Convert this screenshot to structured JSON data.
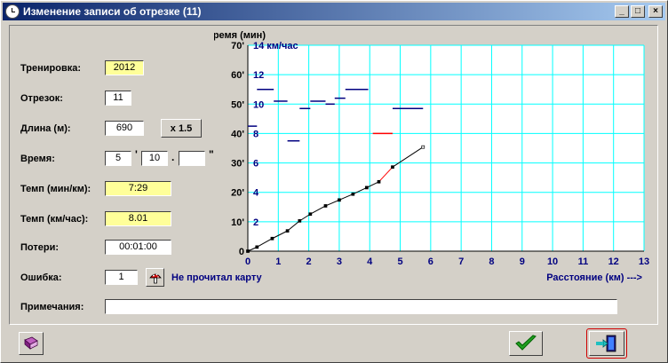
{
  "window": {
    "title": "Изменение записи об отрезке (11)",
    "min_label": "_",
    "max_label": "□",
    "close_label": "×"
  },
  "form": {
    "training_label": "Тренировка:",
    "training_value": "2012",
    "segment_label": "Отрезок:",
    "segment_value": "11",
    "length_label": "Длина (м):",
    "length_value": "690",
    "multiply_button": "x 1.5",
    "time_label": "Время:",
    "time_min": "5",
    "time_sep1": "'",
    "time_sec": "10",
    "time_sep2": ".",
    "time_frac": "",
    "time_sep3": "\"",
    "pace_label": "Темп (мин/км):",
    "pace_value": "7:29",
    "speed_label": "Темп (км/час):",
    "speed_value": "8.01",
    "loss_label": "Потери:",
    "loss_value": "00:01:00",
    "error_label": "Ошибка:",
    "error_value": "1",
    "error_note": "Не прочитал карту",
    "notes_label": "Примечания:",
    "notes_value": ""
  },
  "buttons": {
    "book_icon": "book-icon",
    "ok_icon": "checkmark-icon",
    "exit_icon": "exit-door-icon"
  },
  "colors": {
    "plot_grid": "#00ffff",
    "speed_bar": "#000080",
    "current_segment": "#ff0000",
    "axis_text": "#000080"
  },
  "chart_data": {
    "type": "line",
    "ylabel": "Время (мин)",
    "xlabel": "Расстояние (км) --->",
    "x_ticks": [
      "0",
      "1",
      "2",
      "3",
      "4",
      "5",
      "6",
      "7",
      "8",
      "9",
      "10",
      "11",
      "12",
      "13"
    ],
    "y_ticks": [
      "0",
      "10'",
      "20'",
      "30'",
      "40'",
      "50'",
      "60'",
      "70'"
    ],
    "speed_ticks": [
      "2",
      "4",
      "6",
      "8",
      "10",
      "12"
    ],
    "speed_top_label": "14 км/час",
    "xlim": [
      0,
      13
    ],
    "ylim": [
      0,
      70
    ],
    "speed_lim": [
      0,
      14
    ],
    "cumulative": {
      "x": [
        0,
        0.3,
        0.8,
        1.3,
        1.7,
        2.05,
        2.55,
        3.0,
        3.45,
        3.9,
        4.3,
        4.75,
        5.75
      ],
      "y": [
        0,
        1.4,
        4.3,
        6.9,
        10.3,
        12.6,
        15.4,
        17.4,
        19.4,
        21.6,
        23.6,
        28.6,
        35.4
      ],
      "highlight_segment_index": 10
    },
    "speed_bars": [
      {
        "x0": 0.0,
        "x1": 0.3,
        "speed": 8.5
      },
      {
        "x0": 0.3,
        "x1": 0.85,
        "speed": 11.0
      },
      {
        "x0": 0.85,
        "x1": 1.3,
        "speed": 10.2
      },
      {
        "x0": 1.3,
        "x1": 1.7,
        "speed": 7.5
      },
      {
        "x0": 1.7,
        "x1": 2.05,
        "speed": 9.7
      },
      {
        "x0": 2.05,
        "x1": 2.55,
        "speed": 10.2
      },
      {
        "x0": 2.55,
        "x1": 2.85,
        "speed": 10.0
      },
      {
        "x0": 2.85,
        "x1": 3.2,
        "speed": 10.4
      },
      {
        "x0": 3.2,
        "x1": 3.95,
        "speed": 11.0
      },
      {
        "x0": 4.1,
        "x1": 4.75,
        "speed": 8.0,
        "current": true
      },
      {
        "x0": 4.75,
        "x1": 5.75,
        "speed": 9.7
      }
    ]
  }
}
